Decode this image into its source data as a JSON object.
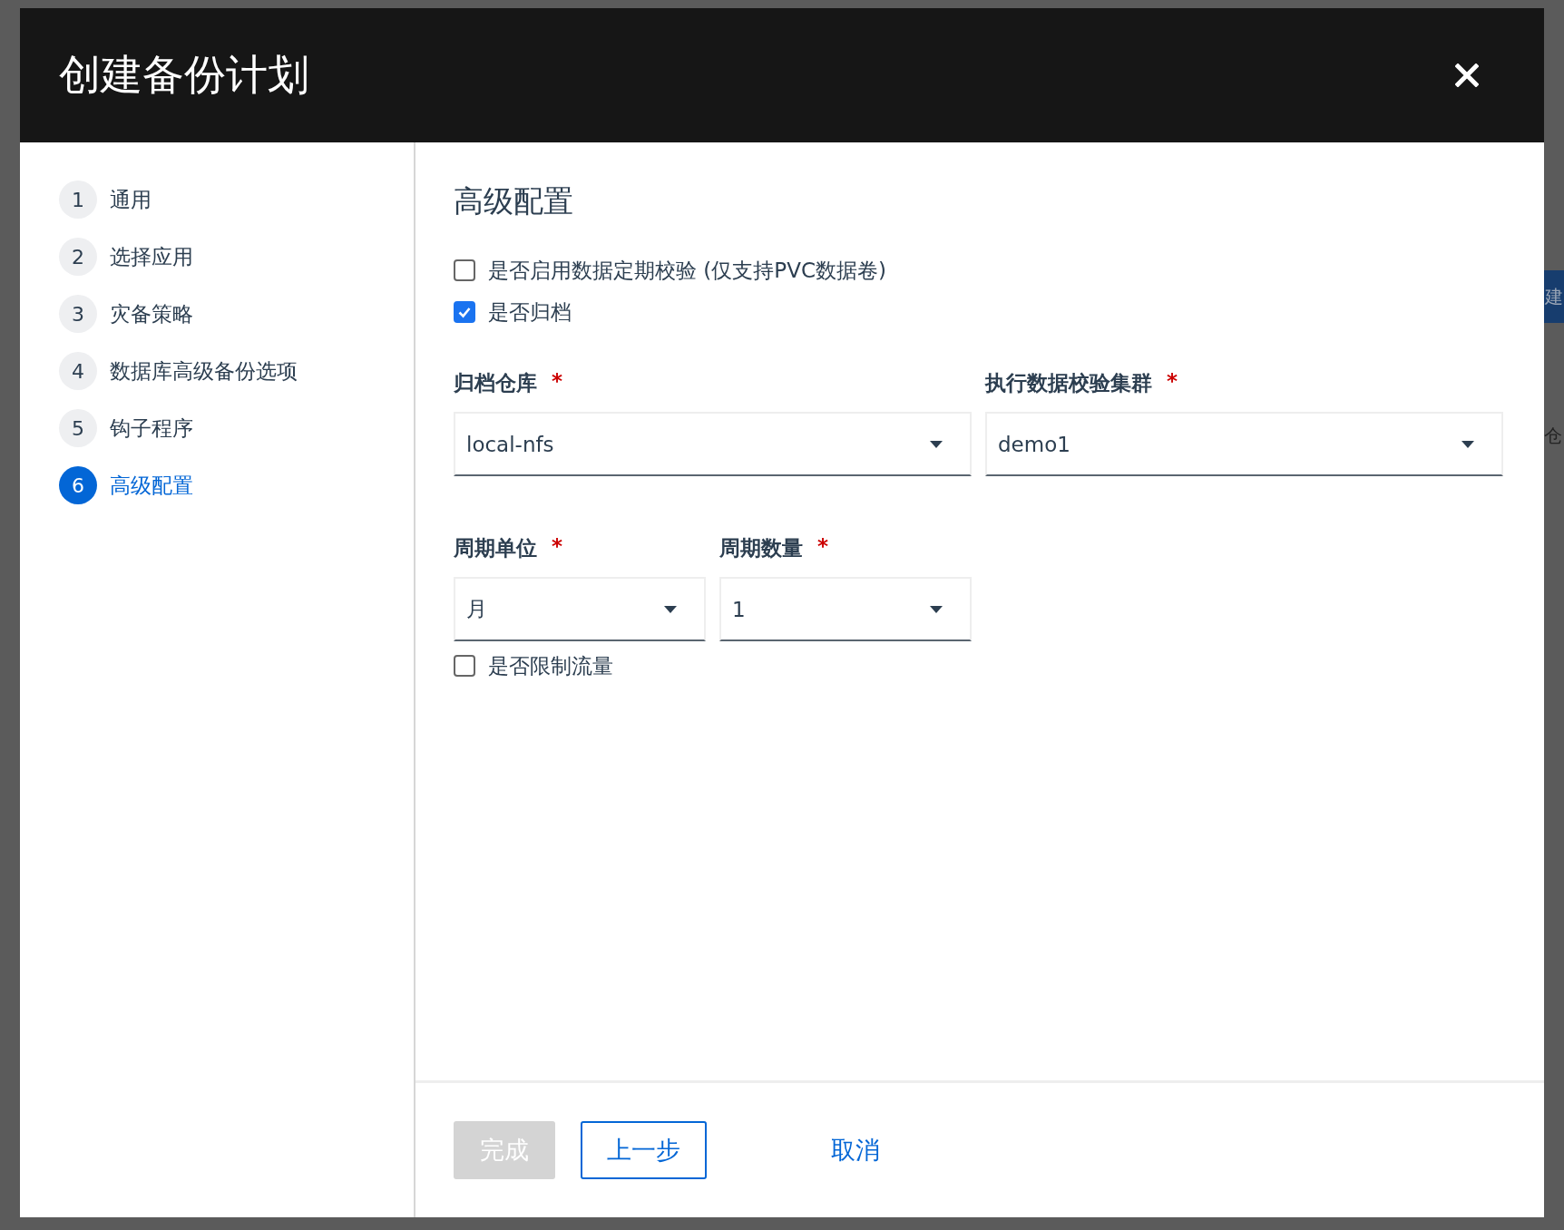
{
  "dialog": {
    "title": "创建备份计划"
  },
  "steps": [
    {
      "number": "1",
      "label": "通用",
      "selected": false
    },
    {
      "number": "2",
      "label": "选择应用",
      "selected": false
    },
    {
      "number": "3",
      "label": "灾备策略",
      "selected": false
    },
    {
      "number": "4",
      "label": "数据库高级备份选项",
      "selected": false
    },
    {
      "number": "5",
      "label": "钩子程序",
      "selected": false
    },
    {
      "number": "6",
      "label": "高级配置",
      "selected": true
    }
  ],
  "form": {
    "heading": "高级配置",
    "options": [
      {
        "label": "是否启用数据定期校验 (仅支持PVC数据卷)",
        "checked": false
      },
      {
        "label": "是否归档",
        "checked": true
      }
    ],
    "field_rows": [
      [
        {
          "label": "归档仓库",
          "required_mark": "*",
          "value": "local-nfs"
        },
        {
          "label": "执行数据校验集群",
          "required_mark": "*",
          "value": "demo1"
        }
      ],
      [
        {
          "label": "周期单位",
          "required_mark": "*",
          "value": "月"
        },
        {
          "label": "周期数量",
          "required_mark": "*",
          "value": "1"
        }
      ]
    ],
    "limit_option": {
      "label": "是否限制流量",
      "checked": false
    }
  },
  "footer_buttons": [
    {
      "label": "完成",
      "kind": "primary",
      "disabled": true
    },
    {
      "label": "上一步",
      "kind": "outline",
      "disabled": false
    },
    {
      "label": "取消",
      "kind": "link",
      "disabled": false
    }
  ],
  "background": {
    "button": "建",
    "text": "仓"
  }
}
